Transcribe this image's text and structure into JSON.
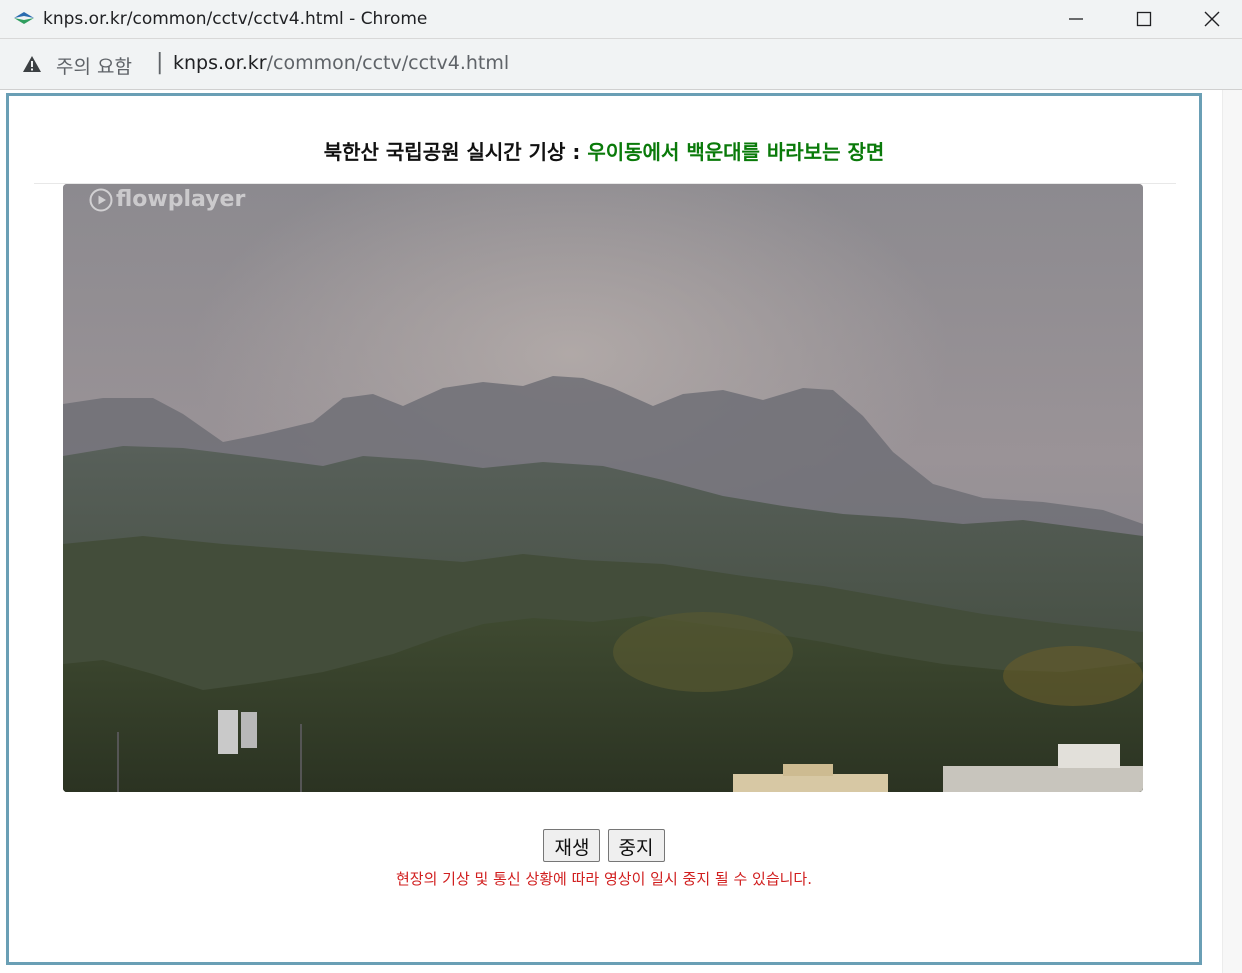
{
  "window": {
    "title": "knps.or.kr/common/cctv/cctv4.html - Chrome"
  },
  "addressbar": {
    "security_label": "주의 요함",
    "separator": "|",
    "url_host": "knps.or.kr",
    "url_path": "/common/cctv/cctv4.html"
  },
  "page": {
    "heading_prefix": "북한산 국립공원 실시간 기상 : ",
    "heading_place": "우이동에서 백운대를 바라보는 장면",
    "player_brand": "flowplayer",
    "play_button": "재생",
    "stop_button": "중지",
    "notice": "현장의 기상 및 통신 상황에 따라 영상이 일시 중지 될 수 있습니다."
  },
  "colors": {
    "frame_border": "#6a9fb5",
    "place_green": "#0a7a0a",
    "notice_red": "#d11f1f"
  },
  "icons": [
    "favicon-icon",
    "minimize-icon",
    "maximize-icon",
    "close-icon",
    "warning-icon",
    "flowplayer-play-icon"
  ]
}
